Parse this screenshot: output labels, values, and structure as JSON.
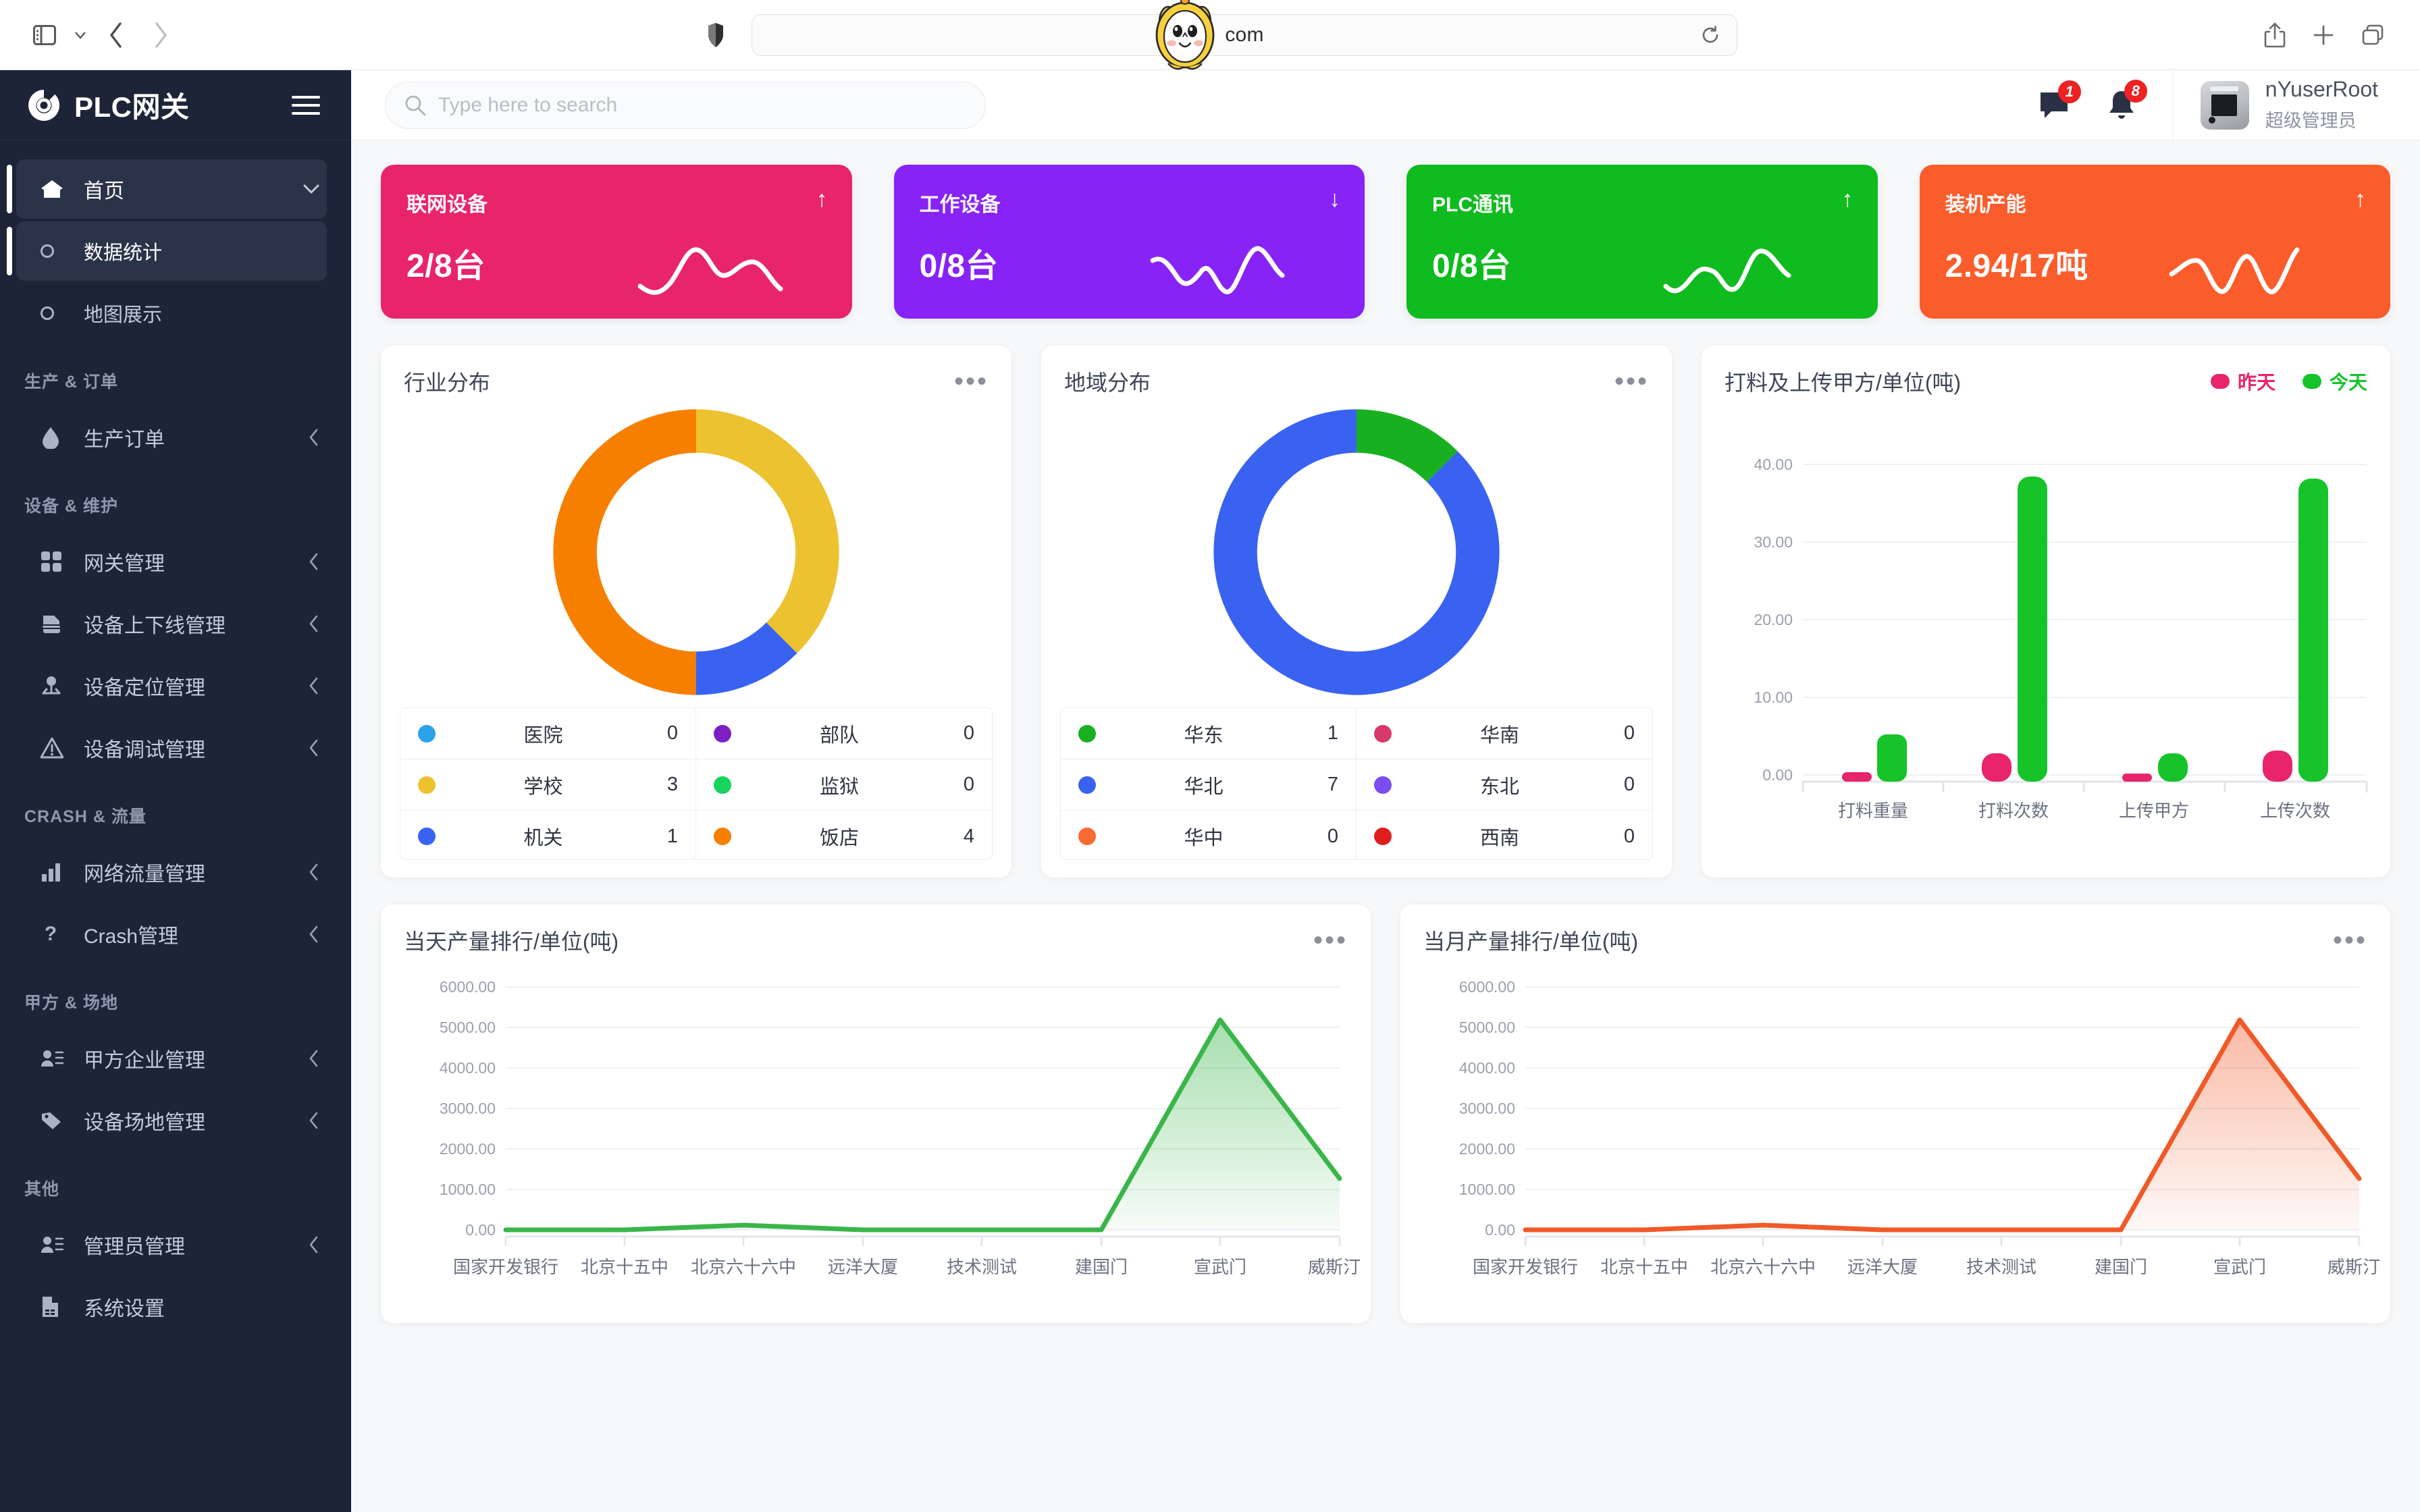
{
  "browser": {
    "url": "com",
    "sidebar_toggle_icon": "sidebar-toggle-icon",
    "chevron_down_icon": "chevron-down-icon",
    "back_icon": "back-arrow-icon",
    "forward_icon": "forward-arrow-icon",
    "shield_icon": "shield-icon",
    "reload_icon": "reload-icon",
    "share_icon": "share-icon",
    "new_tab_icon": "plus-icon",
    "tabs_icon": "tabs-overview-icon"
  },
  "sidebar": {
    "brand": "PLC网关",
    "menu_icon": "hamburger-menu-icon",
    "groups": [
      {
        "label": "",
        "items": [
          {
            "label": "首页",
            "icon": "home-icon",
            "active": true,
            "expanded": true,
            "arrow": "chevron-down"
          },
          {
            "label": "数据统计",
            "icon": "circle-icon",
            "sub": true,
            "selected": true
          },
          {
            "label": "地图展示",
            "icon": "circle-icon",
            "sub": true
          }
        ]
      },
      {
        "label": "生产 & 订单",
        "items": [
          {
            "label": "生产订单",
            "icon": "droplet-icon",
            "arrow": "chevron-left"
          }
        ]
      },
      {
        "label": "设备 & 维护",
        "items": [
          {
            "label": "网关管理",
            "icon": "grid-icon",
            "arrow": "chevron-left"
          },
          {
            "label": "设备上下线管理",
            "icon": "device-icon",
            "arrow": "chevron-left"
          },
          {
            "label": "设备定位管理",
            "icon": "location-pin-icon",
            "arrow": "chevron-left"
          },
          {
            "label": "设备调试管理",
            "icon": "warning-triangle-icon",
            "arrow": "chevron-left"
          }
        ]
      },
      {
        "label": "CRASH & 流量",
        "items": [
          {
            "label": "网络流量管理",
            "icon": "bar-chart-icon",
            "arrow": "chevron-left"
          },
          {
            "label": "Crash管理",
            "icon": "question-mark-icon",
            "arrow": "chevron-left"
          }
        ]
      },
      {
        "label": "甲方 & 场地",
        "items": [
          {
            "label": "甲方企业管理",
            "icon": "user-list-icon",
            "arrow": "chevron-left"
          },
          {
            "label": "设备场地管理",
            "icon": "tag-icon",
            "arrow": "chevron-left"
          }
        ]
      },
      {
        "label": "其他",
        "items": [
          {
            "label": "管理员管理",
            "icon": "user-list-icon",
            "arrow": "chevron-left"
          },
          {
            "label": "系统设置",
            "icon": "file-settings-icon"
          }
        ]
      }
    ]
  },
  "header": {
    "search_placeholder": "Type here to search",
    "search_value": "",
    "search_icon": "search-icon",
    "message_icon": "message-icon",
    "message_badge": "1",
    "bell_icon": "bell-icon",
    "bell_badge": "8",
    "user_name": "nYuserRoot",
    "user_role": "超级管理员",
    "avatar_icon": "plc-device-avatar"
  },
  "stat_cards": [
    {
      "title": "联网设备",
      "value": "2/8台",
      "trend": "up",
      "color": "#e8246b",
      "arrow": "↑"
    },
    {
      "title": "工作设备",
      "value": "0/8台",
      "trend": "down",
      "color": "#8723f5",
      "arrow": "↓"
    },
    {
      "title": "PLC通讯",
      "value": "0/8台",
      "trend": "up",
      "color": "#0fbb1e",
      "arrow": "↑"
    },
    {
      "title": "装机产能",
      "value": "2.94/17吨",
      "trend": "up",
      "color": "#fa5d2b",
      "arrow": "↑"
    }
  ],
  "chart_data": [
    {
      "type": "pie",
      "id": "industry-distribution",
      "title": "行业分布",
      "menu_icon": "more-options-icon",
      "categories": [
        "医院",
        "学校",
        "机关",
        "部队",
        "监狱",
        "饭店"
      ],
      "values": [
        0,
        3,
        1,
        0,
        0,
        4
      ],
      "colors": [
        "#2aa3e8",
        "#edc230",
        "#3a62f0",
        "#7c20c4",
        "#18d45e",
        "#f77f00"
      ],
      "legend_position": "bottom",
      "legend_layout": "2-column-table"
    },
    {
      "type": "pie",
      "id": "region-distribution",
      "title": "地域分布",
      "menu_icon": "more-options-icon",
      "categories": [
        "华东",
        "华北",
        "华中",
        "华南",
        "东北",
        "西南"
      ],
      "values": [
        1,
        7,
        0,
        0,
        0,
        0
      ],
      "colors": [
        "#18b021",
        "#3a62f0",
        "#fa6a33",
        "#d8396b",
        "#7c4df0",
        "#e01d1d"
      ],
      "legend_position": "bottom",
      "legend_layout": "2-column-table"
    },
    {
      "type": "bar",
      "id": "feed-upload-bar",
      "title": "打料及上传甲方/单位(吨)",
      "categories": [
        "打料重量",
        "打料次数",
        "上传甲方",
        "上传次数"
      ],
      "series": [
        {
          "name": "昨天",
          "color": "#e8246b",
          "values": [
            0.3,
            2.8,
            0.25,
            3.0
          ]
        },
        {
          "name": "今天",
          "color": "#16c42a",
          "values": [
            5.2,
            38.4,
            2.8,
            38.2
          ]
        }
      ],
      "ylim": [
        0,
        40
      ],
      "yticks": [
        "0.00",
        "10.00",
        "20.00",
        "30.00",
        "40.00"
      ],
      "ylabel": "",
      "xlabel": "",
      "grid": true,
      "legend_position": "top-right"
    },
    {
      "type": "area",
      "id": "daily-output-rank",
      "title": "当天产量排行/单位(吨)",
      "menu_icon": "more-options-icon",
      "color": "#3ab54a",
      "categories": [
        "国家开发银行",
        "北京十五中",
        "北京六十六中",
        "远洋大厦",
        "技术测试",
        "建国门",
        "宣武门",
        "威斯汀"
      ],
      "values": [
        0,
        0,
        110,
        0,
        0,
        0,
        5180,
        1270
      ],
      "ylim": [
        0,
        6500
      ],
      "yticks": [
        "0.00",
        "1000.00",
        "2000.00",
        "3000.00",
        "4000.00",
        "5000.00",
        "6000.00"
      ],
      "grid": true
    },
    {
      "type": "area",
      "id": "monthly-output-rank",
      "title": "当月产量排行/单位(吨)",
      "menu_icon": "more-options-icon",
      "color": "#f05a28",
      "categories": [
        "国家开发银行",
        "北京十五中",
        "北京六十六中",
        "远洋大厦",
        "技术测试",
        "建国门",
        "宣武门",
        "威斯汀"
      ],
      "values": [
        0,
        0,
        110,
        0,
        0,
        0,
        5180,
        1270
      ],
      "ylim": [
        0,
        6500
      ],
      "yticks": [
        "0.00",
        "1000.00",
        "2000.00",
        "3000.00",
        "4000.00",
        "5000.00",
        "6000.00"
      ],
      "grid": true
    }
  ]
}
